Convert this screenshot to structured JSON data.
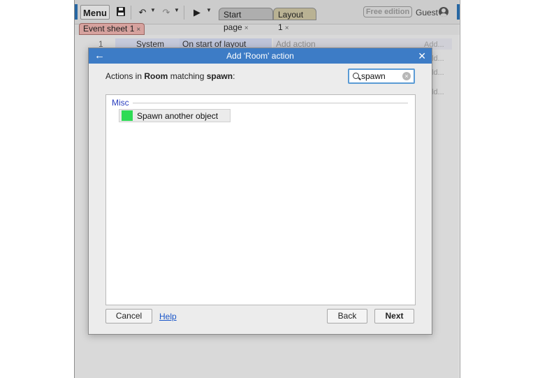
{
  "toolbar": {
    "menu_label": "Menu",
    "tabs": [
      {
        "label": "Start page",
        "close": "×"
      },
      {
        "label": "Layout 1",
        "close": "×"
      }
    ],
    "edition_badge": "Free edition",
    "user_label": "Guest"
  },
  "event_sheet_tab": {
    "label": "Event sheet 1",
    "close": "×"
  },
  "event_row": {
    "number": "1",
    "object": "System",
    "condition": "On start of layout",
    "add_action": "Add action"
  },
  "side_hints": [
    "Add...",
    "Add...",
    "Add...",
    "Add..."
  ],
  "dialog": {
    "back_glyph": "←",
    "title": "Add 'Room' action",
    "close_glyph": "✕",
    "heading_prefix": "Actions in ",
    "heading_object": "Room",
    "heading_mid": " matching ",
    "heading_query": "spawn",
    "heading_suffix": ":",
    "search": {
      "value": "spawn",
      "clear_glyph": "×"
    },
    "category": "Misc",
    "actions": [
      {
        "label": "Spawn another object",
        "color": "#2edb55"
      }
    ],
    "buttons": {
      "cancel": "Cancel",
      "help": "Help",
      "back": "Back",
      "next": "Next"
    }
  },
  "colors": {
    "titlebar": "#3d7cc6",
    "category_text": "#2a3fbf",
    "link": "#1a56c9",
    "search_focus": "#5b9bd5"
  }
}
